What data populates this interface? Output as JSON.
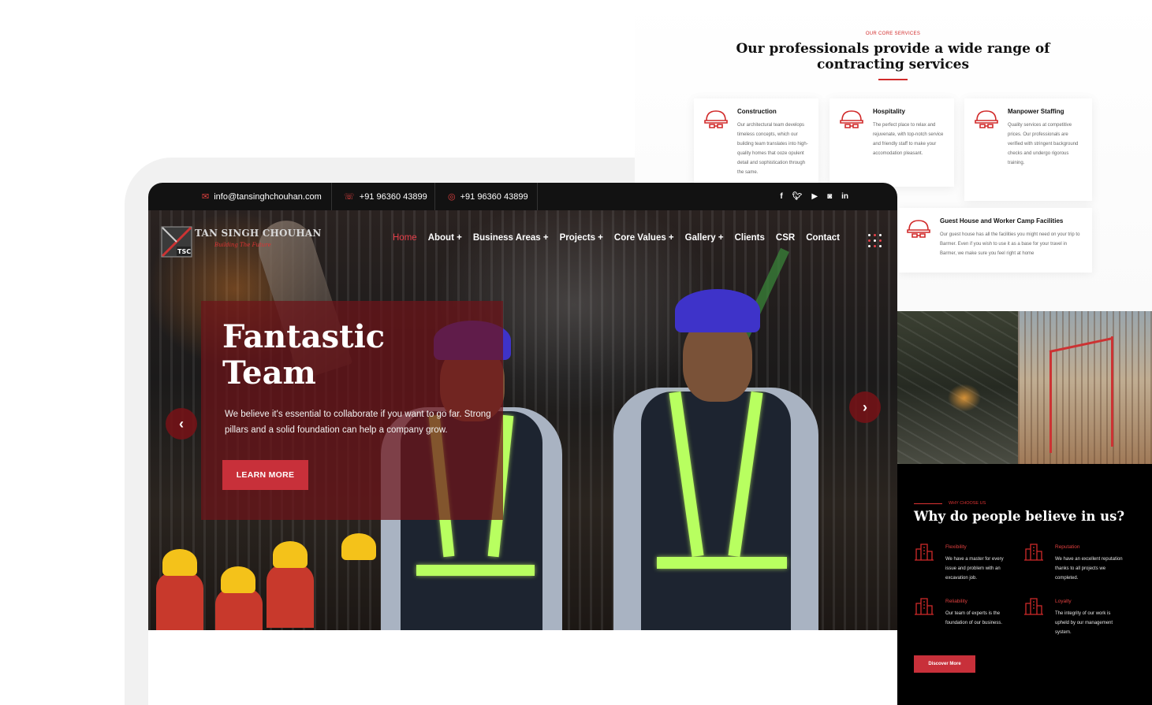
{
  "services": {
    "eyebrow": "OUR CORE SERVICES",
    "title": "Our professionals provide a wide range of contracting services",
    "cards": [
      {
        "title": "Construction",
        "text": "Our architectural team develops timeless concepts, which our building team translates into high-quality homes that ooze opulent detail and sophistication through the same.",
        "icon": "hard-hat-icon"
      },
      {
        "title": "Hospitality",
        "text": "The perfect place to relax and rejuvenate, with top-notch service and friendly staff to make your accomodation pleasant.",
        "icon": "hard-hat-icon"
      },
      {
        "title": "Manpower Staffing",
        "text": "Quality services at competitive prices. Our professionals are verified with stringent background checks and undergo rigorous training.",
        "icon": "hard-hat-icon"
      },
      {
        "title": "Guest House and Worker Camp Facilities",
        "text": "Our guest house has all the facilities you might need on your trip to Barmer. Even if you wish to use it as a base for your travel in Barmer, we make sure you feel right at home",
        "icon": "hard-hat-icon"
      }
    ]
  },
  "topbar": {
    "email": "info@tansinghchouhan.com",
    "phone": "+91 96360 43899",
    "whatsapp": "+91 96360 43899",
    "socials": [
      "facebook-icon",
      "twitter-icon",
      "youtube-icon",
      "instagram-icon",
      "linkedin-icon"
    ]
  },
  "brand": {
    "name": "TAN SINGH CHOUHAN",
    "tagline": "Building The Future",
    "logo_text": "TSC"
  },
  "nav": {
    "items": [
      {
        "label": "Home",
        "active": true
      },
      {
        "label": "About +"
      },
      {
        "label": "Business Areas +"
      },
      {
        "label": "Projects +"
      },
      {
        "label": "Core Values +"
      },
      {
        "label": "Gallery +"
      },
      {
        "label": "Clients"
      },
      {
        "label": "CSR"
      },
      {
        "label": "Contact"
      }
    ]
  },
  "hero": {
    "title": "Fantastic Team",
    "text": "We believe it's essential to collaborate if you want to go far. Strong pillars and a solid foundation can help a company grow.",
    "button": "LEARN MORE",
    "prev_icon": "‹",
    "next_icon": "›"
  },
  "why": {
    "eyebrow": "WHY CHOOSE US",
    "title": "Why do people believe in us?",
    "items": [
      {
        "title": "Flexibility",
        "text": "We have a master for every issue and problem with an excavation job."
      },
      {
        "title": "Reputation",
        "text": "We have an excellent reputation thanks to all projects we completed."
      },
      {
        "title": "Reliability",
        "text": "Our team of experts is the foundation of our business."
      },
      {
        "title": "Loyalty",
        "text": "The integrity of our work is upheld by our management system."
      }
    ],
    "button": "Discover More"
  },
  "colors": {
    "accent": "#c8303a",
    "dark": "#121212",
    "panel": "#6e1419"
  }
}
